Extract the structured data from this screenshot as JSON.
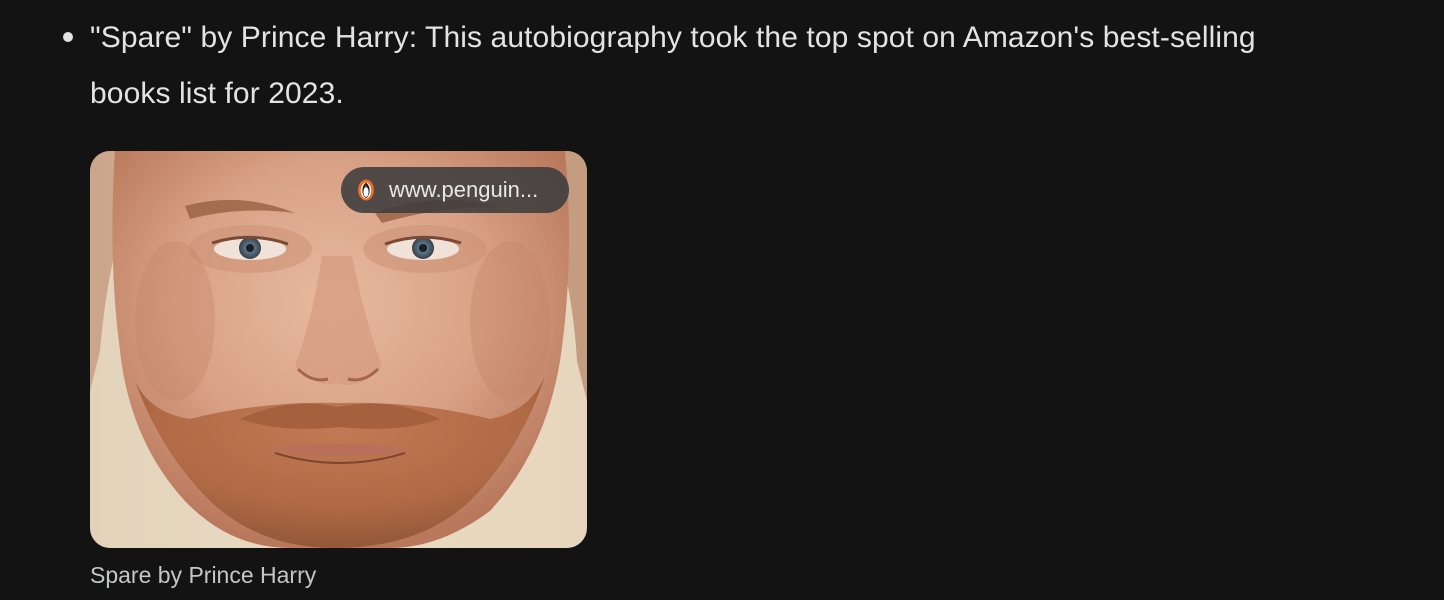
{
  "response": {
    "bullet_text": "\"Spare\" by Prince Harry: This autobiography took the top spot on Amazon's best-selling books list for 2023."
  },
  "image_card": {
    "source_label": "www.penguin...",
    "source_icon": "penguin-logo-icon",
    "caption": "Spare by Prince Harry",
    "image_subject": "Prince Harry portrait"
  },
  "colors": {
    "background": "#131314",
    "text": "#e3e3e3",
    "caption": "#c4c7c5",
    "chip_background": "#3c3c3e",
    "penguin_orange": "#f26b1d"
  }
}
